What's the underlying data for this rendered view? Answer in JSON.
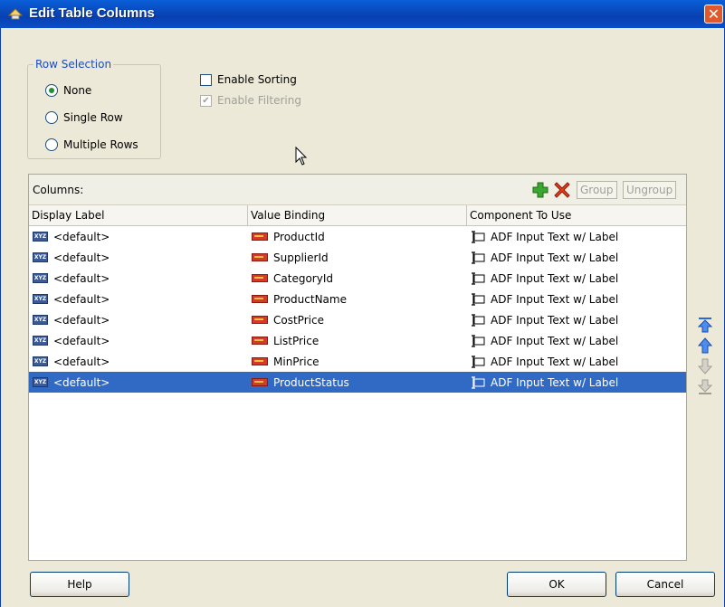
{
  "window": {
    "title": "Edit Table Columns",
    "close_glyph": "✕"
  },
  "row_selection": {
    "legend": "Row Selection",
    "options": [
      {
        "label": "None",
        "selected": true
      },
      {
        "label": "Single Row",
        "selected": false
      },
      {
        "label": "Multiple Rows",
        "selected": false
      }
    ]
  },
  "options": {
    "enable_sorting": {
      "label": "Enable Sorting",
      "checked": false,
      "enabled": true
    },
    "enable_filtering": {
      "label": "Enable Filtering",
      "checked": true,
      "enabled": false
    }
  },
  "columns_panel": {
    "label": "Columns:",
    "toolbar": {
      "add_icon": "add-icon",
      "delete_icon": "delete-icon",
      "group_label": "Group",
      "ungroup_label": "Ungroup"
    },
    "headers": [
      "Display Label",
      "Value Binding",
      "Component To Use"
    ],
    "rows": [
      {
        "display_label": "<default>",
        "value_binding": "ProductId",
        "component": "ADF Input Text w/ Label",
        "selected": false
      },
      {
        "display_label": "<default>",
        "value_binding": "SupplierId",
        "component": "ADF Input Text w/ Label",
        "selected": false
      },
      {
        "display_label": "<default>",
        "value_binding": "CategoryId",
        "component": "ADF Input Text w/ Label",
        "selected": false
      },
      {
        "display_label": "<default>",
        "value_binding": "ProductName",
        "component": "ADF Input Text w/ Label",
        "selected": false
      },
      {
        "display_label": "<default>",
        "value_binding": "CostPrice",
        "component": "ADF Input Text w/ Label",
        "selected": false
      },
      {
        "display_label": "<default>",
        "value_binding": "ListPrice",
        "component": "ADF Input Text w/ Label",
        "selected": false
      },
      {
        "display_label": "<default>",
        "value_binding": "MinPrice",
        "component": "ADF Input Text w/ Label",
        "selected": false
      },
      {
        "display_label": "<default>",
        "value_binding": "ProductStatus",
        "component": "ADF Input Text w/ Label",
        "selected": true
      }
    ]
  },
  "side_buttons": [
    "move-to-top-icon",
    "move-up-icon",
    "move-down-icon",
    "move-to-bottom-icon"
  ],
  "footer": {
    "help_label": "Help",
    "ok_label": "OK",
    "cancel_label": "Cancel"
  },
  "colors": {
    "titlebar": "#0a4fc8",
    "selection": "#316ac5",
    "dialog_bg": "#ece9d8"
  }
}
